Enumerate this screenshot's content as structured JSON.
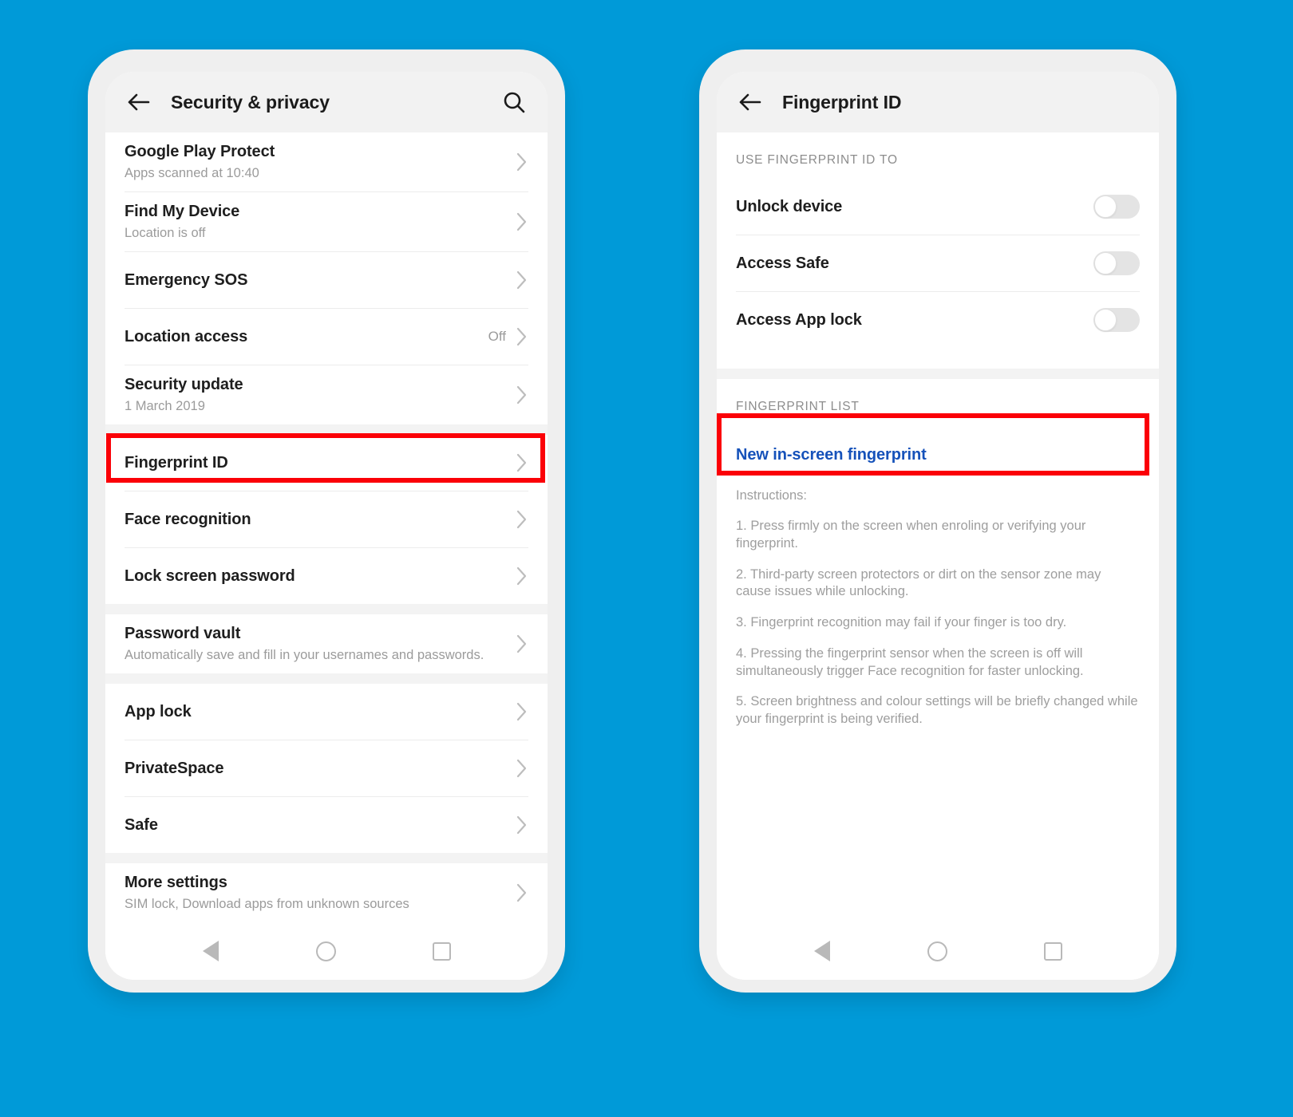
{
  "background_color": "#009ad8",
  "highlight_color": "#fb0007",
  "link_color": "#1652ba",
  "left_phone": {
    "appbar": {
      "back_icon": "arrow-left-icon",
      "title": "Security & privacy",
      "search_icon": "search-icon"
    },
    "groups": [
      {
        "items": [
          {
            "title": "Google Play Protect",
            "subtitle": "Apps scanned at 10:40",
            "value": "",
            "chevron": true
          },
          {
            "title": "Find My Device",
            "subtitle": "Location is off",
            "value": "",
            "chevron": true
          },
          {
            "title": "Emergency SOS",
            "subtitle": "",
            "value": "",
            "chevron": true
          },
          {
            "title": "Location access",
            "subtitle": "",
            "value": "Off",
            "chevron": true
          },
          {
            "title": "Security update",
            "subtitle": "1 March 2019",
            "value": "",
            "chevron": true
          }
        ]
      },
      {
        "items": [
          {
            "title": "Fingerprint ID",
            "subtitle": "",
            "value": "",
            "chevron": true,
            "highlighted": true
          },
          {
            "title": "Face recognition",
            "subtitle": "",
            "value": "",
            "chevron": true
          },
          {
            "title": "Lock screen password",
            "subtitle": "",
            "value": "",
            "chevron": true
          }
        ]
      },
      {
        "items": [
          {
            "title": "Password vault",
            "subtitle": "Automatically save and fill in your usernames and passwords.",
            "value": "",
            "chevron": true
          }
        ]
      },
      {
        "items": [
          {
            "title": "App lock",
            "subtitle": "",
            "value": "",
            "chevron": true
          },
          {
            "title": "PrivateSpace",
            "subtitle": "",
            "value": "",
            "chevron": true
          },
          {
            "title": "Safe",
            "subtitle": "",
            "value": "",
            "chevron": true
          }
        ]
      },
      {
        "items": [
          {
            "title": "More settings",
            "subtitle": "SIM lock, Download apps from unknown sources",
            "value": "",
            "chevron": true
          }
        ]
      }
    ],
    "navbar": {
      "back": "nav-back-triangle",
      "home": "nav-home-circle",
      "recents": "nav-recents-square"
    }
  },
  "right_phone": {
    "appbar": {
      "back_icon": "arrow-left-icon",
      "title": "Fingerprint ID"
    },
    "use_section": {
      "label": "USE FINGERPRINT ID TO",
      "toggles": [
        {
          "label": "Unlock device",
          "state": "off"
        },
        {
          "label": "Access Safe",
          "state": "off"
        },
        {
          "label": "Access App lock",
          "state": "off"
        }
      ]
    },
    "list_section": {
      "label": "FINGERPRINT LIST",
      "new_link": "New in-screen fingerprint",
      "highlighted": true
    },
    "instructions": {
      "heading": "Instructions:",
      "items": [
        "1. Press firmly on the screen when enroling or verifying your fingerprint.",
        "2. Third-party screen protectors or dirt on the sensor zone may cause issues while unlocking.",
        "3. Fingerprint recognition may fail if your finger is too dry.",
        "4. Pressing the fingerprint sensor when the screen is off will simultaneously trigger Face recognition for faster unlocking.",
        "5. Screen brightness and colour settings will be briefly changed while your fingerprint is being verified."
      ]
    },
    "navbar": {
      "back": "nav-back-triangle",
      "home": "nav-home-circle",
      "recents": "nav-recents-square"
    }
  }
}
